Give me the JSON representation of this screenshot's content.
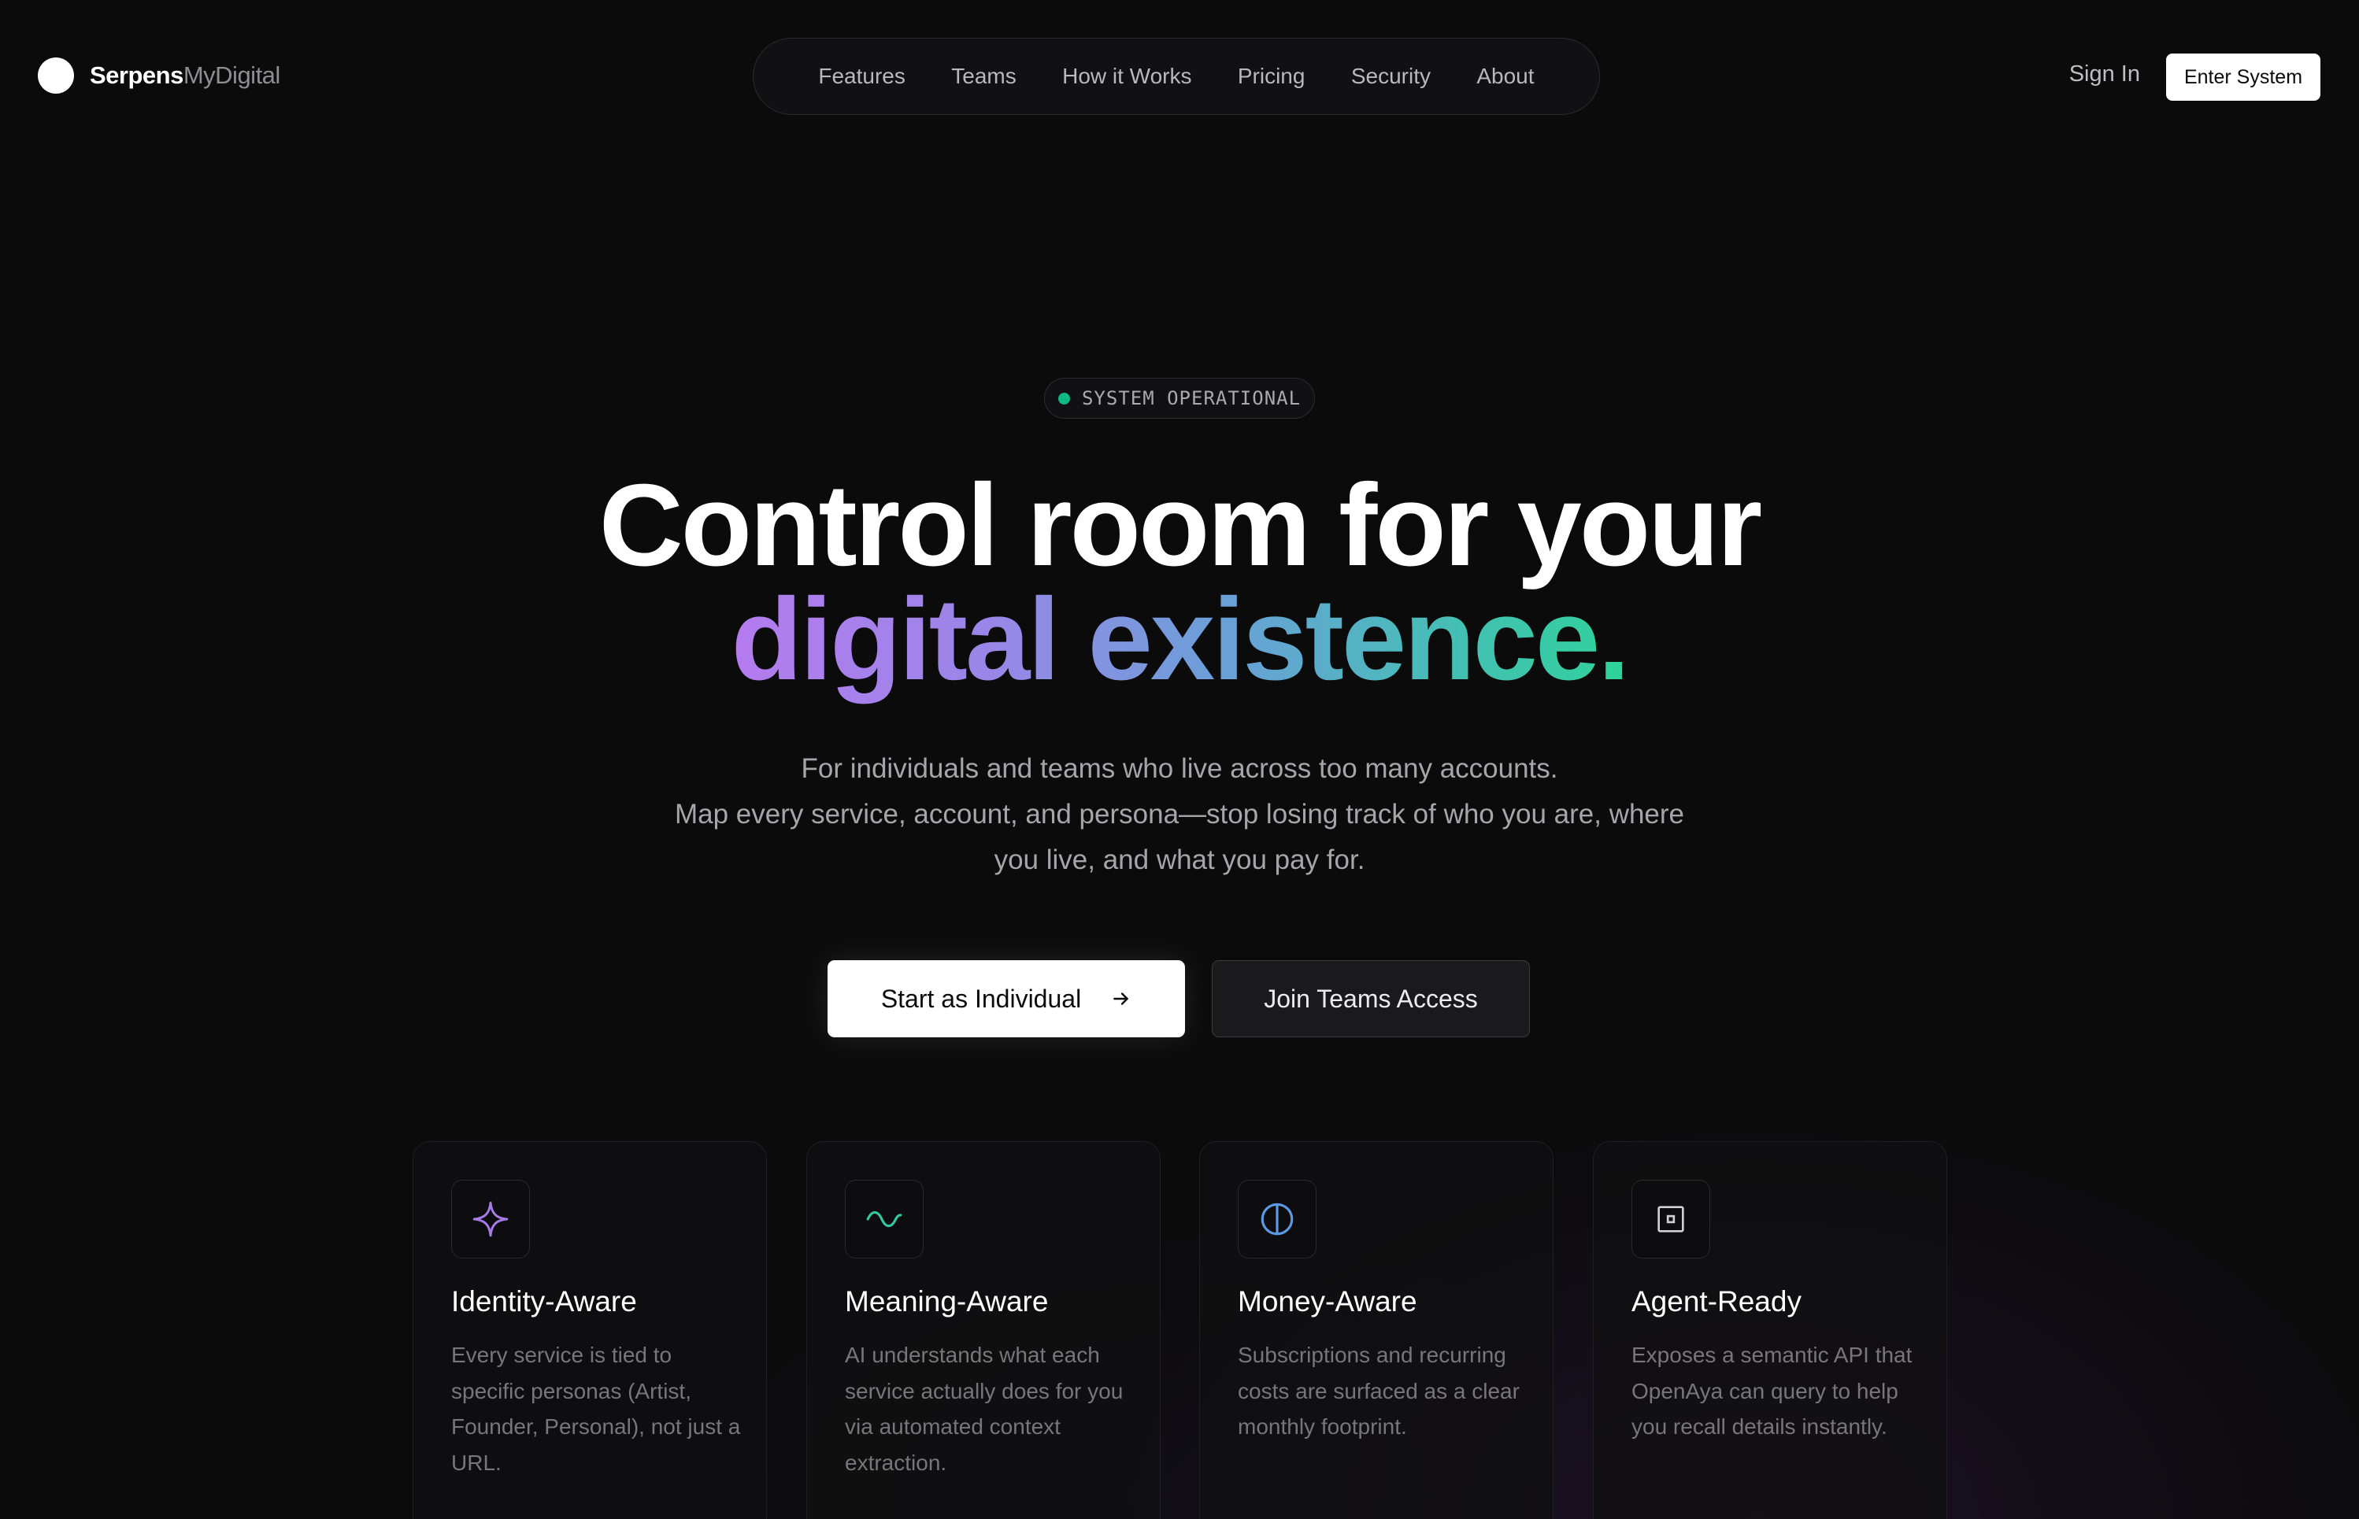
{
  "header": {
    "logo_bold": "Serpens",
    "logo_light": "MyDigital",
    "nav": [
      {
        "label": "Features"
      },
      {
        "label": "Teams"
      },
      {
        "label": "How it Works"
      },
      {
        "label": "Pricing"
      },
      {
        "label": "Security"
      },
      {
        "label": "About"
      }
    ],
    "sign_in": "Sign In",
    "enter_system": "Enter System"
  },
  "hero": {
    "status": "SYSTEM OPERATIONAL",
    "title_line1": "Control room for your",
    "title_line2": "digital existence.",
    "subtitle_lines": [
      "For individuals and teams who live across too many accounts.",
      "Map every service, account, and persona—stop losing track of who you are, where",
      "you live, and what you pay for."
    ],
    "primary_cta": "Start as Individual",
    "secondary_cta": "Join Teams Access"
  },
  "features": [
    {
      "icon": "sparkle-icon",
      "title": "Identity-Aware",
      "desc": "Every service is tied to specific personas (Artist, Founder, Personal), not just a URL."
    },
    {
      "icon": "wave-icon",
      "title": "Meaning-Aware",
      "desc": "AI understands what each service actually does for you via automated context extraction."
    },
    {
      "icon": "half-circle-icon",
      "title": "Money-Aware",
      "desc": "Subscriptions and recurring costs are surfaced as a clear monthly footprint."
    },
    {
      "icon": "chip-icon",
      "title": "Agent-Ready",
      "desc": "Exposes a semantic API that OpenAya can query to help you recall details instantly."
    }
  ],
  "colors": {
    "background": "#0b0b0c",
    "status_green": "#10b981",
    "gradient_start": "#b57bee",
    "gradient_end": "#2fd39a",
    "icon_purple": "#a77be8",
    "icon_teal": "#34c9a0",
    "icon_blue": "#5b9be6",
    "icon_gray": "#cfcfd4"
  }
}
